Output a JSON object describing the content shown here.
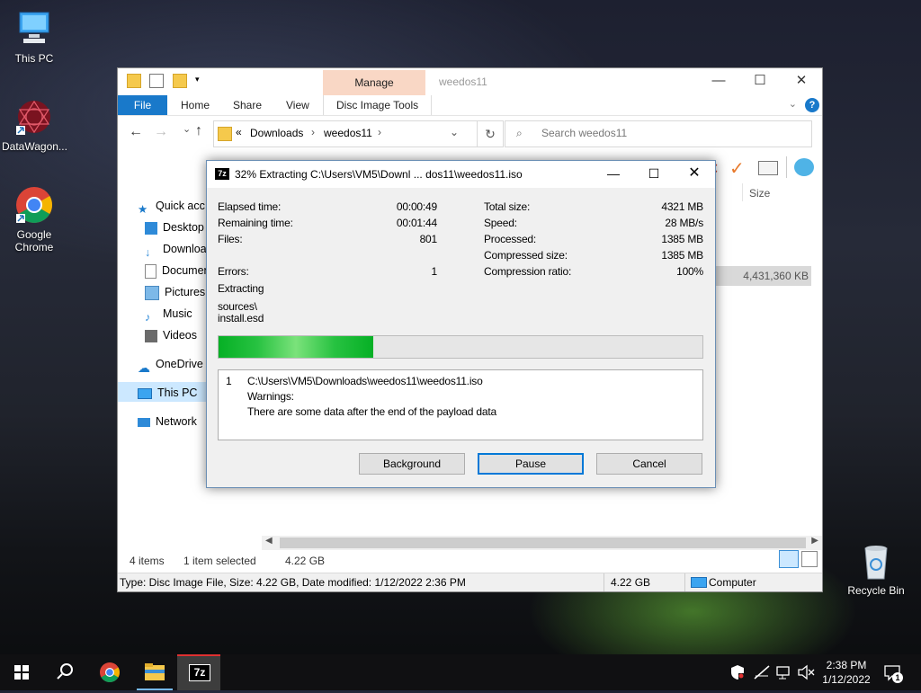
{
  "desktop": {
    "icons": [
      {
        "label": "This PC",
        "icon": "computer-icon"
      },
      {
        "label": "DataWagon...",
        "icon": "datawagon-icon"
      },
      {
        "label": "Google Chrome",
        "icon": "chrome-icon"
      },
      {
        "label": "Recycle Bin",
        "icon": "recycle-bin-icon"
      }
    ]
  },
  "explorer": {
    "title": "weedos11",
    "manage_tab": "Manage",
    "ribbon": {
      "file": "File",
      "tabs": [
        "Home",
        "Share",
        "View",
        "Disc Image Tools"
      ]
    },
    "address": {
      "chevron": "«",
      "crumbs": [
        "Downloads",
        "weedos11"
      ]
    },
    "search_placeholder": "Search weedos11",
    "nav": [
      "Quick access",
      "Desktop",
      "Downloads",
      "Documents",
      "Pictures",
      "Music",
      "Videos",
      "OneDrive",
      "This PC",
      "Network"
    ],
    "column_size": "Size",
    "selected_size": "4,431,360 KB",
    "status": {
      "items": "4 items",
      "selected": "1 item selected",
      "size": "4.22 GB"
    },
    "details_bar": {
      "type": "Type: Disc Image File, Size: 4.22 GB, Date modified: 1/12/2022 2:36 PM",
      "size": "4.22 GB",
      "location": "Computer"
    }
  },
  "dialog": {
    "title": "32% Extracting C:\\Users\\VM5\\Downl ... dos11\\weedos11.iso",
    "app_badge": "7z",
    "left": {
      "elapsed_label": "Elapsed time:",
      "elapsed": "00:00:49",
      "remaining_label": "Remaining time:",
      "remaining": "00:01:44",
      "files_label": "Files:",
      "files": "801",
      "errors_label": "Errors:",
      "errors": "1",
      "extracting_label": "Extracting",
      "current_path": "sources\\",
      "current_file": "install.esd"
    },
    "right": {
      "total_label": "Total size:",
      "total": "4321 MB",
      "speed_label": "Speed:",
      "speed": "28 MB/s",
      "processed_label": "Processed:",
      "processed": "1385 MB",
      "compressed_label": "Compressed size:",
      "compressed": "1385 MB",
      "ratio_label": "Compression ratio:",
      "ratio": "100%"
    },
    "progress": 0.32,
    "messages": {
      "index": "1",
      "path": "C:\\Users\\VM5\\Downloads\\weedos11\\weedos11.iso",
      "warnings_label": "Warnings:",
      "warning_text": "There are some data after the end of the payload data"
    },
    "buttons": {
      "background": "Background",
      "pause": "Pause",
      "cancel": "Cancel"
    }
  },
  "taskbar": {
    "clock_time": "2:38 PM",
    "clock_date": "1/12/2022",
    "notification_count": "1",
    "active_app": "7z"
  },
  "colors": {
    "accent": "#1979ca",
    "progress": "#1bb33a",
    "manage_tab": "#f9d7c5"
  }
}
